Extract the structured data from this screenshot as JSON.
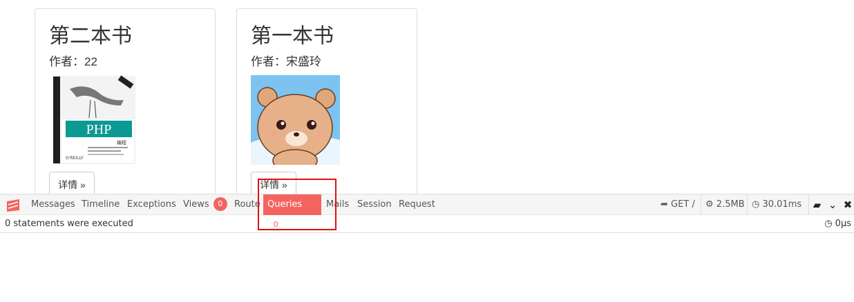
{
  "books": [
    {
      "title": "第二本书",
      "author": "作者：22",
      "cover": "php-programming-cover",
      "button": "详情 »"
    },
    {
      "title": "第一本书",
      "author": "作者：宋盛玲",
      "cover": "bear-cartoon-cover",
      "button": "详情 »"
    }
  ],
  "debugbar": {
    "tabs": [
      {
        "label": "Messages"
      },
      {
        "label": "Timeline"
      },
      {
        "label": "Exceptions"
      },
      {
        "label": "Views",
        "badge": "0"
      },
      {
        "label": "Route"
      },
      {
        "label": "Queries",
        "badge": "0",
        "active": true
      },
      {
        "label": "Mails"
      },
      {
        "label": "Session"
      },
      {
        "label": "Request"
      }
    ],
    "method": "GET /",
    "memory": "2.5MB",
    "time": "30.01ms",
    "body_text": "0 statements were executed",
    "body_time": "0μs",
    "accent_color": "#f4645f"
  }
}
